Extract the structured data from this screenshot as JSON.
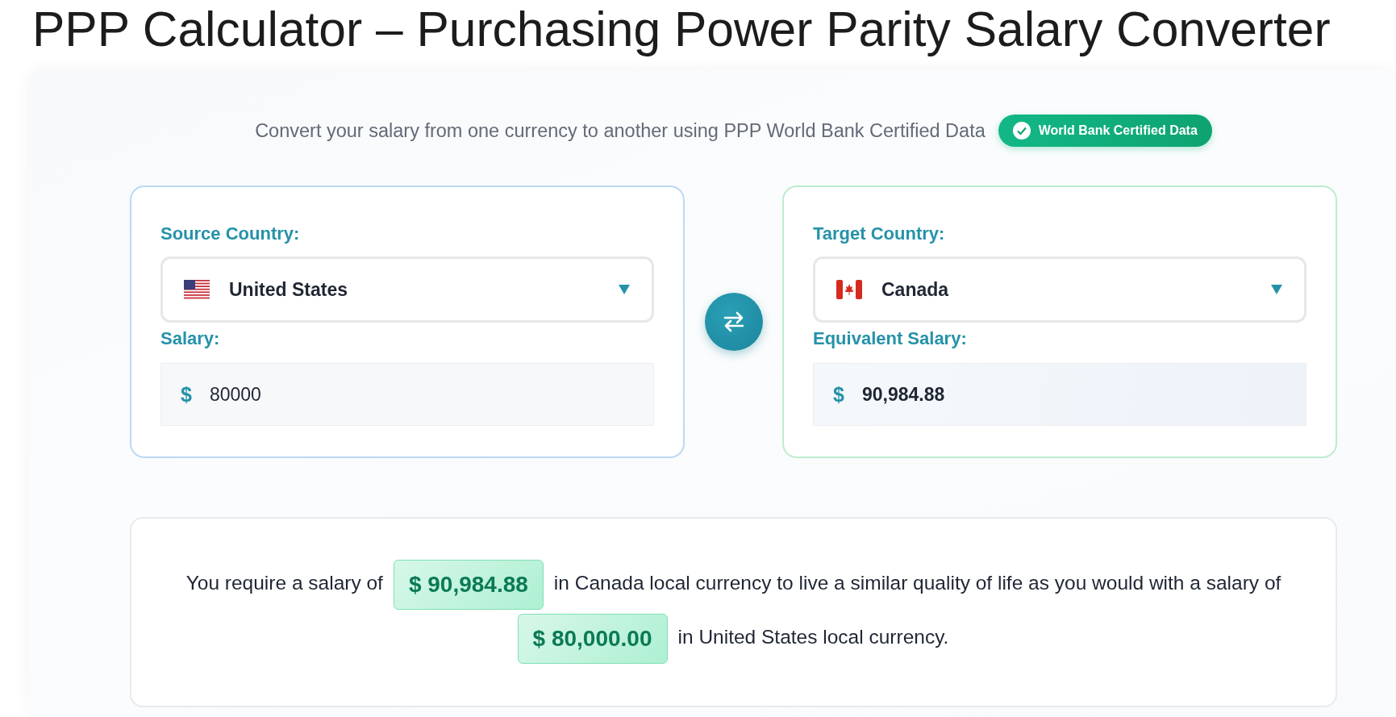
{
  "title": "PPP Calculator – Purchasing Power Parity Salary Converter",
  "subtitle": "Convert your salary from one currency to another using PPP World Bank Certified Data",
  "badge": {
    "label": "World Bank Certified Data"
  },
  "cards": [
    {
      "kind": "source",
      "country_label": "Source Country:",
      "country": "United States",
      "flag": {
        "kind": "us"
      },
      "amount_label": "Salary:",
      "currency": "$",
      "value": "80000"
    },
    {
      "kind": "target",
      "country_label": "Target Country:",
      "country": "Canada",
      "flag": {
        "kind": "ca"
      },
      "amount_label": "Equivalent Salary:",
      "currency": "$",
      "value": "90,984.88"
    }
  ],
  "result": {
    "parts": [
      {
        "kind": "text",
        "text": "You require a salary of"
      },
      {
        "kind": "amount",
        "text": "$ 90,984.88"
      },
      {
        "kind": "text",
        "text": "in Canada local currency to live a similar quality of life as you would with a salary of"
      },
      {
        "kind": "amount",
        "text": "$ 80,000.00"
      },
      {
        "kind": "text",
        "text": "in United States local currency."
      }
    ]
  }
}
